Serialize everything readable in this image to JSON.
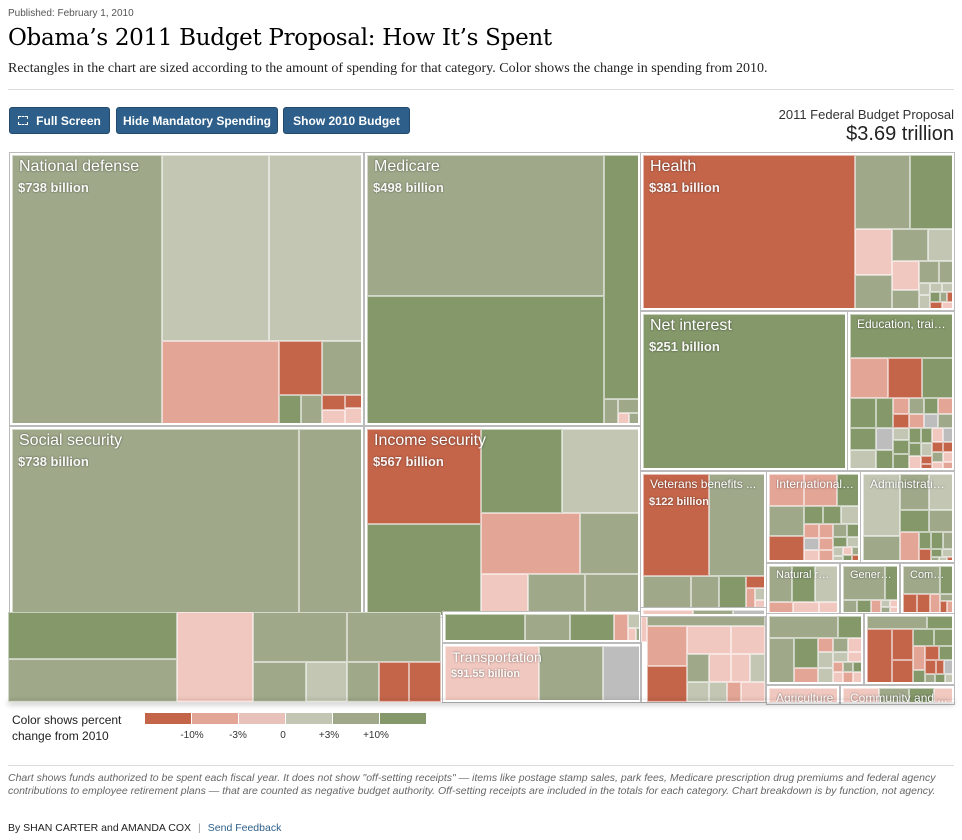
{
  "header": {
    "published": "Published: February 1, 2010",
    "title": "Obama’s 2011 Budget Proposal: How It’s Spent",
    "subtitle": "Rectangles in the chart are sized according to the amount of spending for that category. Color shows the change in spending from 2010."
  },
  "toolbar": {
    "full_screen_label": "Full Screen",
    "full_screen_icon": "fullscreen-icon",
    "hide_mandatory_label": "Hide Mandatory Spending",
    "show_2010_label": "Show 2010 Budget"
  },
  "total": {
    "label": "2011 Federal Budget Proposal",
    "value": "$3.69 trillion"
  },
  "colors": {
    "lt_-10": "#c4654a",
    "-10_-3": "#e3a596",
    "-3_0": "#f1c8bf",
    "0_3": "#c2c6b3",
    "3_10": "#9fa98a",
    "gt_10": "#84986a",
    "none": "#bdbdbd",
    "button": "#2e5f8a"
  },
  "chart_data": {
    "type": "treemap",
    "title": "Obama’s 2011 Budget Proposal: How It’s Spent",
    "total": "$3.69 trillion",
    "categories": [
      {
        "name": "National defense",
        "amount": "$738 billion",
        "amount_billions": 738
      },
      {
        "name": "Social security",
        "amount": "$738 billion",
        "amount_billions": 738
      },
      {
        "name": "Medicare",
        "amount": "$498 billion",
        "amount_billions": 498
      },
      {
        "name": "Income security",
        "amount": "$567 billion",
        "amount_billions": 567
      },
      {
        "name": "Health",
        "amount": "$381 billion",
        "amount_billions": 381
      },
      {
        "name": "Net interest",
        "amount": "$251 billion",
        "amount_billions": 251
      },
      {
        "name": "Education, train...",
        "amount": "",
        "amount_billions": null
      },
      {
        "name": "Veterans benefits ...",
        "amount": "$122 billion",
        "amount_billions": 122
      },
      {
        "name": "International a...",
        "amount": "",
        "amount_billions": null
      },
      {
        "name": "Administratio...",
        "amount": "",
        "amount_billions": null
      },
      {
        "name": "Natural res...",
        "amount": "",
        "amount_billions": null
      },
      {
        "name": "General ...",
        "amount": "",
        "amount_billions": null
      },
      {
        "name": "Comme...",
        "amount": "",
        "amount_billions": null
      },
      {
        "name": "Transportation",
        "amount": "$91.55 billion",
        "amount_billions": 91.55
      },
      {
        "name": "Agriculture",
        "amount": "",
        "amount_billions": null
      },
      {
        "name": "Community and ...",
        "amount": "",
        "amount_billions": null
      }
    ],
    "legend": {
      "title": "Color shows percent change from 2010",
      "bins": [
        "< -10%",
        "-10% to -3%",
        "-3% to 0",
        "0 to +3%",
        "+3% to +10%",
        "> +10%"
      ],
      "tick_labels": [
        "-10%",
        "-3%",
        "0",
        "+3%",
        "+10%"
      ]
    }
  },
  "legend": {
    "title_line1": "Color shows percent",
    "title_line2": "change from 2010",
    "ticks": [
      "-10%",
      "-3%",
      "0",
      "+3%",
      "+10%"
    ]
  },
  "footer": {
    "note": "Chart shows funds authorized to be spent each fiscal year. It does not show \"off-setting receipts\" — items like postage stamp sales, park fees, Medicare prescription drug premiums and federal agency contributions to employee retirement plans — that are counted as negative budget authority. Off-setting receipts are included in the totals for each category. Chart breakdown is by function, not agency.",
    "byline": "By SHAN CARTER and AMANDA COX",
    "separator": "|",
    "feedback_link": "Send Feedback"
  }
}
